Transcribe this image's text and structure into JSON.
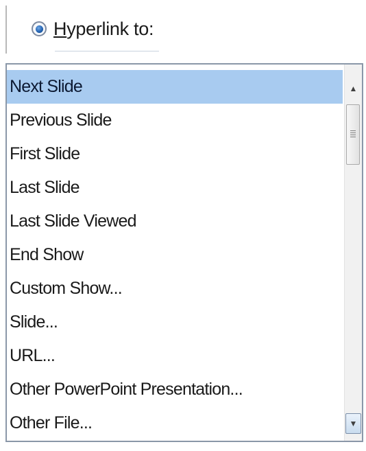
{
  "hyperlink": {
    "label_mnemonic": "H",
    "label_rest": "yperlink to:",
    "selected": true
  },
  "list": {
    "items": [
      "Next Slide",
      "Previous Slide",
      "First Slide",
      "Last Slide",
      "Last Slide Viewed",
      "End Show",
      "Custom Show...",
      "Slide...",
      "URL...",
      "Other PowerPoint Presentation...",
      "Other File..."
    ],
    "selected_index": 0
  },
  "scrollbar": {
    "up_icon": "scroll-up-arrow-icon",
    "down_icon": "scroll-down-arrow-icon"
  },
  "colors": {
    "selection": "#a8cbf0",
    "border": "#8a97a8"
  }
}
